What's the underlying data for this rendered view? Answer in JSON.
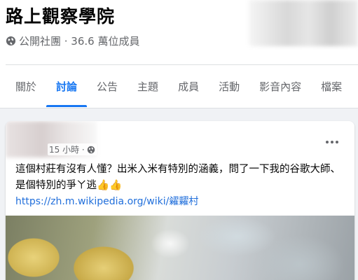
{
  "group": {
    "title": "路上觀察學院",
    "meta": "公開社團 · 36.6 萬位成員"
  },
  "tabs": [
    {
      "label": "關於",
      "active": false
    },
    {
      "label": "討論",
      "active": true
    },
    {
      "label": "公告",
      "active": false
    },
    {
      "label": "主題",
      "active": false
    },
    {
      "label": "成員",
      "active": false
    },
    {
      "label": "活動",
      "active": false
    },
    {
      "label": "影音內容",
      "active": false
    },
    {
      "label": "檔案",
      "active": false
    }
  ],
  "post": {
    "time": "15 小時 ·",
    "text": "這個村莊有沒有人懂？出米入米有特別的涵義，問了一下我的谷歌大師、是個特別的爭ㄚ逃👍👍",
    "link": "https://zh.m.wikipedia.org/wiki/糴糶村"
  },
  "colors": {
    "accent": "#1877f2",
    "link": "#216fdb",
    "secondary_text": "#65676b",
    "background": "#f0f2f5"
  },
  "icons": {
    "privacy": "globe-icon",
    "audience": "globe-icon",
    "menu": "more-options-icon"
  }
}
